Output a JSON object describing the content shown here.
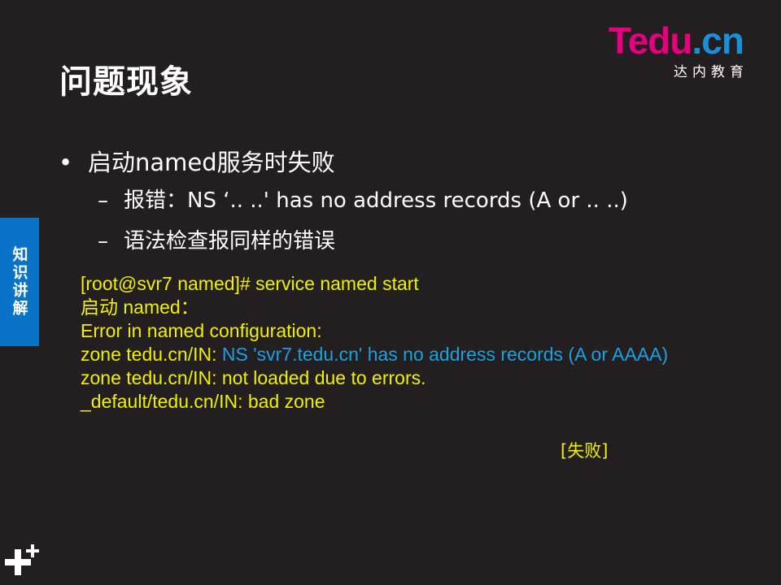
{
  "slide": {
    "title": "问题现象",
    "side_tab": "知识讲解",
    "logo": {
      "brand_t": "T",
      "brand_edu": "edu",
      "brand_dot": ".",
      "brand_cn": "cn",
      "subtitle": "达内教育",
      "colors": {
        "pink": "#e6007e",
        "blue": "#1a8fd8"
      }
    },
    "bullets": {
      "main": "启动named服务时失败",
      "sub1": "报错：NS  ‘.. ..' has no address records (A or .. ..)",
      "sub2": "语法检查报同样的错误",
      "bullet_symbol": "•",
      "dash_symbol": "–"
    },
    "code": {
      "line1": "[root@svr7 named]# service named start",
      "line2": "启动 named：",
      "line3": "Error in named configuration:",
      "line4_prefix": "zone tedu.cn/IN: ",
      "line4_highlight": "NS 'svr7.tedu.cn' has no address records (A or AAAA)",
      "line5": "zone tedu.cn/IN: not loaded due to errors.",
      "line6": "_default/tedu.cn/IN: bad zone",
      "status": "[失败]",
      "colors": {
        "text": "#f0f000",
        "highlight": "#1ca0e0"
      }
    },
    "decor": {
      "icon": "plus-plus-icon"
    },
    "colors": {
      "background": "#231f20",
      "side_tab": "#0a72c7"
    }
  }
}
